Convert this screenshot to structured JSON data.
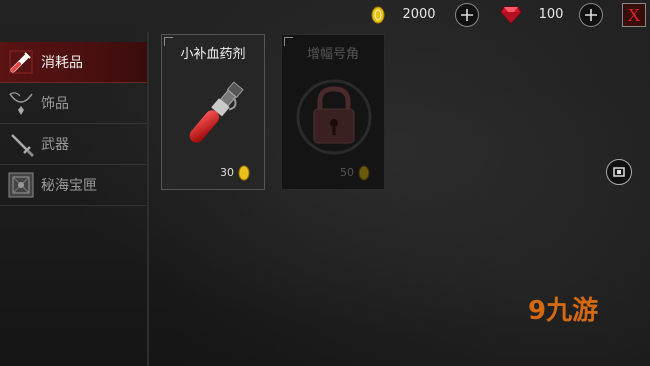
{
  "topbar": {
    "gold_amount": "2000",
    "gem_amount": "100",
    "close_label": "X",
    "gold_icon": "gold-coin-icon",
    "gem_icon": "ruby-gem-icon"
  },
  "sidebar": {
    "items": [
      {
        "label": "消耗品",
        "icon": "potion-icon",
        "active": true
      },
      {
        "label": "饰品",
        "icon": "necklace-icon",
        "active": false
      },
      {
        "label": "武器",
        "icon": "sword-icon",
        "active": false
      },
      {
        "label": "秘海宝匣",
        "icon": "chest-icon",
        "active": false
      }
    ]
  },
  "shop": {
    "items": [
      {
        "name": "小补血药剂",
        "price": "30",
        "locked": false
      },
      {
        "name": "增幅号角",
        "price": "50",
        "locked": true
      }
    ]
  },
  "watermark": "9九游",
  "colors": {
    "active_tab": "#5a1212",
    "gold": "#e8c21a",
    "gem": "#d0142a",
    "close": "#d22222"
  }
}
